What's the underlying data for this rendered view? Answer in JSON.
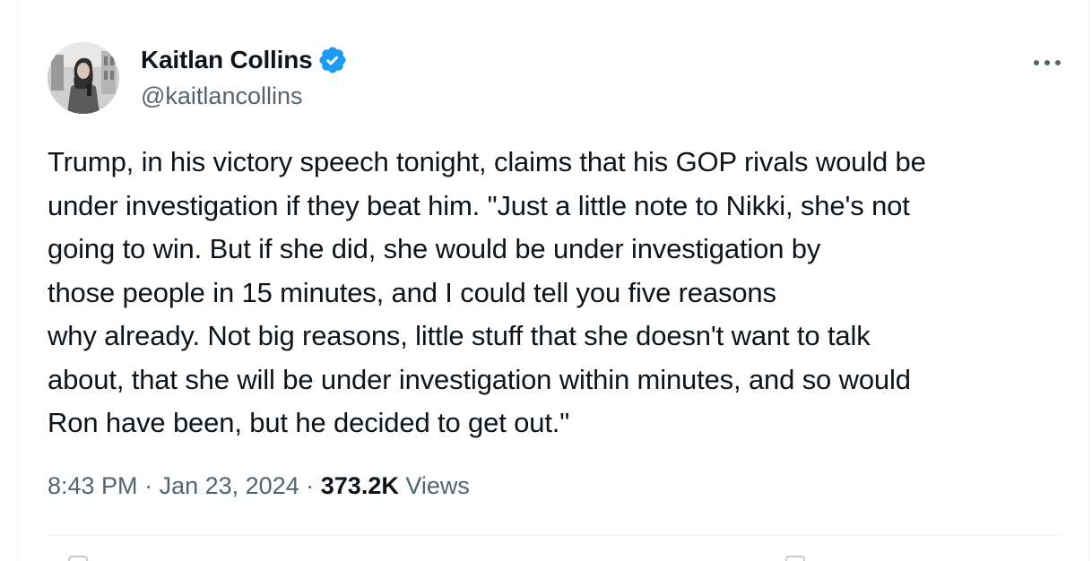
{
  "author": {
    "display_name": "Kaitlan Collins",
    "handle": "@kaitlancollins",
    "verified": true,
    "avatar_icon": "profile-photo",
    "verified_color": "#1d9bf0"
  },
  "tweet": {
    "lines": [
      "Trump, in his victory speech tonight, claims that his GOP rivals would be",
      "under investigation if they beat him. \"Just a little note to Nikki, she's not",
      "going to win. But if she did, she would be under investigation by",
      "those people in 15 minutes, and I could tell you five reasons",
      "why already. Not big reasons, little stuff that she doesn't want to talk",
      "about, that she will be under investigation within minutes, and so would",
      "Ron have been, but he decided to get out.\""
    ]
  },
  "meta": {
    "time": "8:43 PM",
    "separator": "·",
    "date": "Jan 23, 2024",
    "views_count": "373.2K",
    "views_label": "Views"
  },
  "colors": {
    "text_primary": "#0f1419",
    "text_secondary": "#536471",
    "border": "#eff3f4"
  }
}
